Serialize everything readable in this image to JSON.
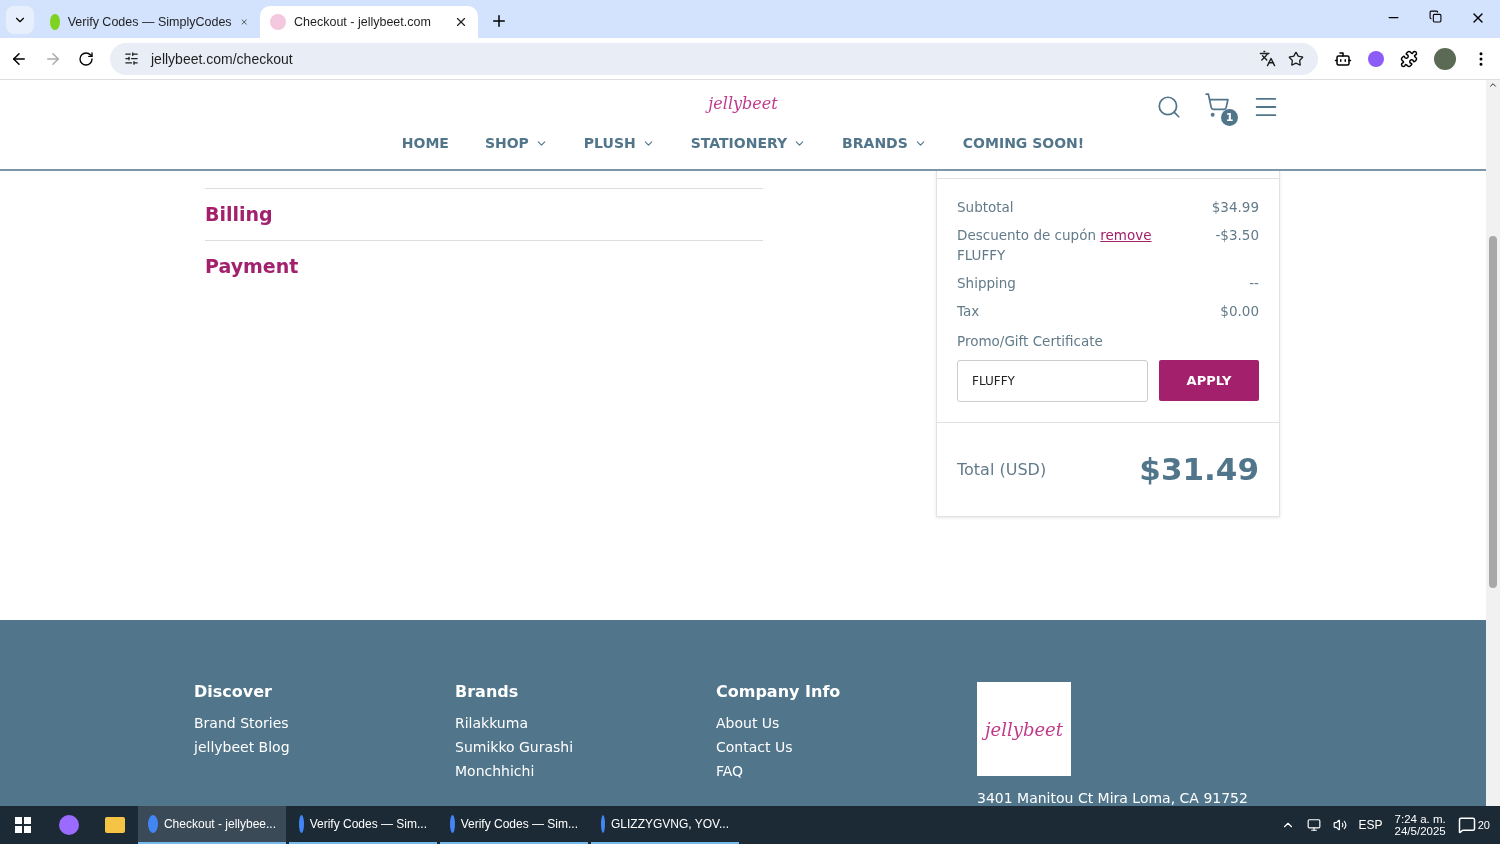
{
  "browser": {
    "tabs": [
      {
        "title": "Verify Codes — SimplyCodes",
        "selected": false
      },
      {
        "title": "Checkout - jellybeet.com",
        "selected": true
      }
    ],
    "url": "jellybeet.com/checkout"
  },
  "header": {
    "logo": "jellybeet",
    "cart_count": "1",
    "nav": [
      {
        "label": "HOME",
        "dropdown": false
      },
      {
        "label": "SHOP",
        "dropdown": true
      },
      {
        "label": "PLUSH",
        "dropdown": true
      },
      {
        "label": "STATIONERY",
        "dropdown": true
      },
      {
        "label": "BRANDS",
        "dropdown": true
      },
      {
        "label": "COMING SOON!",
        "dropdown": false
      }
    ]
  },
  "steps": [
    "Billing",
    "Payment"
  ],
  "summary": {
    "lines": [
      {
        "label": "Subtotal",
        "value": "$34.99"
      },
      {
        "label": "Descuento de cupón",
        "link": "remove",
        "note": "FLUFFY",
        "value": "-$3.50"
      },
      {
        "label": "Shipping",
        "value": "--"
      },
      {
        "label": "Tax",
        "value": "$0.00"
      }
    ],
    "promo_label": "Promo/Gift Certificate",
    "promo_value": "FLUFFY",
    "apply": "APPLY",
    "total_label": "Total (USD)",
    "total": "$31.49"
  },
  "footer": {
    "columns": [
      {
        "title": "Discover",
        "links": [
          "Brand Stories",
          "jellybeet Blog"
        ]
      },
      {
        "title": "Brands",
        "links": [
          "Rilakkuma",
          "Sumikko Gurashi",
          "Monchhichi"
        ]
      },
      {
        "title": "Company Info",
        "links": [
          "About Us",
          "Contact Us",
          "FAQ"
        ]
      }
    ],
    "logo": "jellybeet",
    "address": "3401 Manitou Ct Mira Loma, CA 91752"
  },
  "taskbar": {
    "apps": [
      {
        "title": "Checkout - jellybee...",
        "selected": true
      },
      {
        "title": "Verify Codes — Sim...",
        "selected": false
      },
      {
        "title": "Verify Codes — Sim...",
        "selected": false
      },
      {
        "title": "GLIZZYGVNG, YOV...",
        "selected": false
      }
    ],
    "language": "ESP",
    "time": "7:24 a. m.",
    "date": "24/5/2025",
    "notifications": "20"
  }
}
